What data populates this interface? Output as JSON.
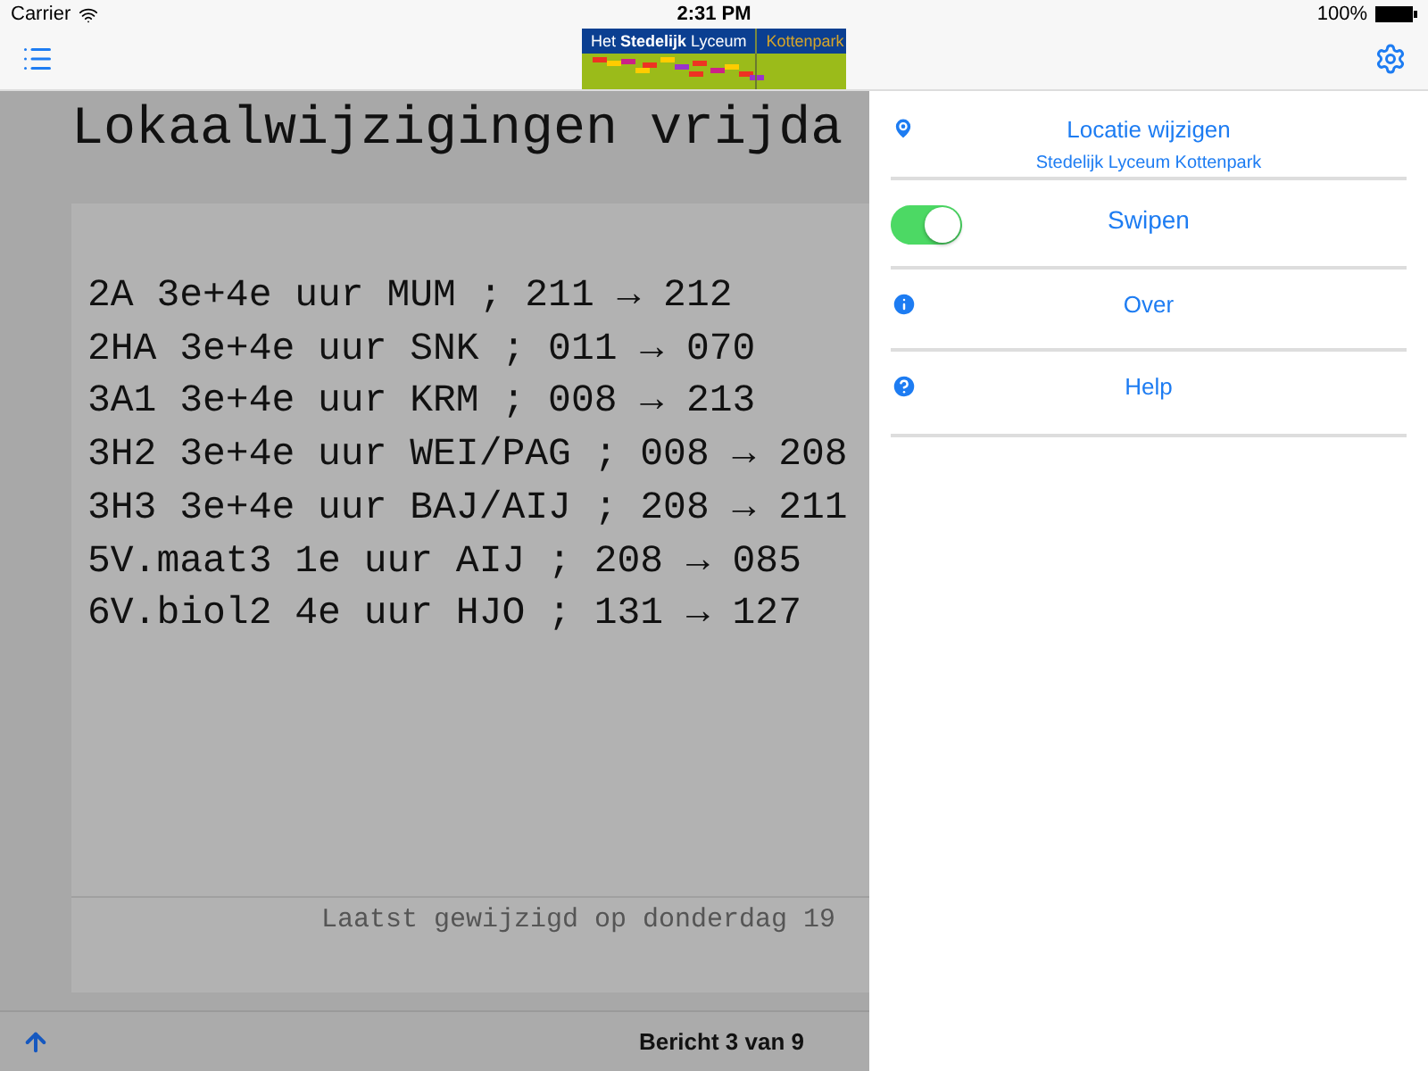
{
  "status_bar": {
    "carrier": "Carrier",
    "time": "2:31 PM",
    "battery": "100%"
  },
  "nav_bar": {
    "logo": {
      "left": "Het **Stedelijk** Lyceum",
      "right": "Kottenpark"
    }
  },
  "message": {
    "title": "Lokaalwijzigingen vrijda",
    "lines": [
      "2A 3e+4e uur MUM ; 211 → 212",
      "2HA 3e+4e uur SNK ; 011 → 070",
      "3A1 3e+4e uur KRM ; 008 → 213",
      "3H2 3e+4e uur WEI/PAG ; 008 → 208",
      "3H3 3e+4e uur BAJ/AIJ ; 208 → 211",
      "5V.maat3 1e uur AIJ ; 208 → 085",
      "6V.biol2 4e uur HJO ; 131 → 127"
    ],
    "footer": "Laatst gewijzigd op donderdag 19"
  },
  "toolbar": {
    "counter": "Bericht 3 van 9"
  },
  "settings": [
    {
      "kind": "location",
      "label": "Locatie wijzigen",
      "detail": "Stedelijk Lyceum Kottenpark"
    },
    {
      "kind": "toggle",
      "label": "Swipen",
      "on": true
    },
    {
      "kind": "info",
      "label": "Over"
    },
    {
      "kind": "help",
      "label": "Help"
    }
  ]
}
